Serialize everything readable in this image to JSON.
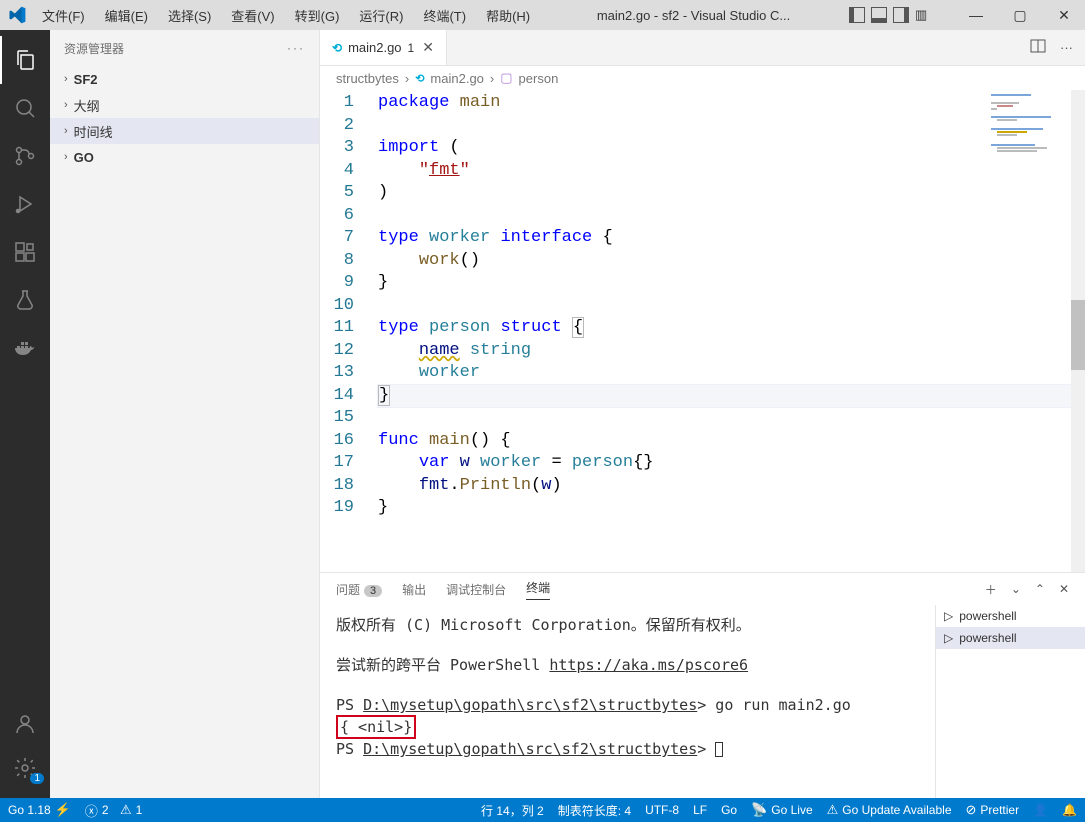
{
  "titlebar": {
    "title": "main2.go - sf2 - Visual Studio C...",
    "menus": [
      "文件(F)",
      "编辑(E)",
      "选择(S)",
      "查看(V)",
      "转到(G)",
      "运行(R)",
      "终端(T)",
      "帮助(H)"
    ]
  },
  "sidebar": {
    "title": "资源管理器",
    "items": [
      {
        "label": "SF2"
      },
      {
        "label": "大纲"
      },
      {
        "label": "时间线"
      },
      {
        "label": "GO"
      }
    ]
  },
  "tab": {
    "filename": "main2.go",
    "modified": "1"
  },
  "breadcrumb": {
    "folder": "structbytes",
    "file": "main2.go",
    "symbol": "person"
  },
  "code": {
    "lines": [
      {
        "n": "1",
        "raw": "package main"
      },
      {
        "n": "2",
        "raw": ""
      },
      {
        "n": "3",
        "raw": "import ("
      },
      {
        "n": "4",
        "raw": "    \"fmt\""
      },
      {
        "n": "5",
        "raw": ")"
      },
      {
        "n": "6",
        "raw": ""
      },
      {
        "n": "7",
        "raw": "type worker interface {"
      },
      {
        "n": "8",
        "raw": "    work()"
      },
      {
        "n": "9",
        "raw": "}"
      },
      {
        "n": "10",
        "raw": ""
      },
      {
        "n": "11",
        "raw": "type person struct {"
      },
      {
        "n": "12",
        "raw": "    name string"
      },
      {
        "n": "13",
        "raw": "    worker"
      },
      {
        "n": "14",
        "raw": "}"
      },
      {
        "n": "15",
        "raw": ""
      },
      {
        "n": "16",
        "raw": "func main() {"
      },
      {
        "n": "17",
        "raw": "    var w worker = person{}"
      },
      {
        "n": "18",
        "raw": "    fmt.Println(w)"
      },
      {
        "n": "19",
        "raw": "}"
      }
    ]
  },
  "panel": {
    "tabs": {
      "problems": "问题",
      "problems_count": "3",
      "output": "输出",
      "debug": "调试控制台",
      "terminal": "终端"
    },
    "terminal_lines": {
      "l1": "版权所有 (C) Microsoft Corporation。保留所有权利。",
      "l2a": "尝试新的跨平台 PowerShell ",
      "l2b": "https://aka.ms/pscore6",
      "l3a": "PS ",
      "l3b": "D:\\mysetup\\gopath\\src\\sf2\\structbytes",
      "l3c": "> go run main2.go",
      "l4": "{ <nil>}",
      "l5a": "PS ",
      "l5b": "D:\\mysetup\\gopath\\src\\sf2\\structbytes",
      "l5c": "> "
    },
    "side": {
      "item1": "powershell",
      "item2": "powershell"
    }
  },
  "statusbar": {
    "go": "Go 1.18",
    "errors": "2",
    "warnings": "1",
    "pos": "行 14，列 2",
    "tab": "制表符长度: 4",
    "enc": "UTF-8",
    "eol": "LF",
    "lang": "Go",
    "live": "Go Live",
    "update": "Go Update Available",
    "prettier": "Prettier"
  }
}
